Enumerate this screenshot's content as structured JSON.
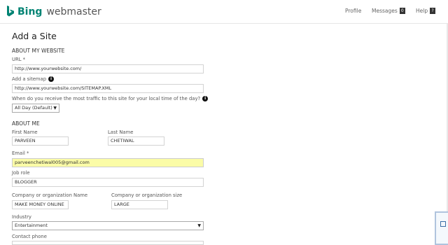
{
  "header": {
    "brand": "Bing",
    "product": "webmaster",
    "nav": {
      "profile": "Profile",
      "messages": "Messages",
      "messages_count": "0",
      "help": "Help",
      "help_badge": "?"
    }
  },
  "page_title": "Add a Site",
  "about_website": {
    "heading": "ABOUT MY WEBSITE",
    "url_label": "URL *",
    "url_value": "http://www.yourwebsite.com/",
    "sitemap_label": "Add a sitemap",
    "sitemap_value": "http://www.yourwebsite.com/SITEMAP.XML",
    "traffic_label": "When do you receive the most traffic to this site for your local time of the day?",
    "traffic_value": "All Day (Default)"
  },
  "about_me": {
    "heading": "ABOUT ME",
    "first_name_label": "First Name",
    "first_name_value": "PARVEEN",
    "last_name_label": "Last Name",
    "last_name_value": "CHETIWAL",
    "email_label": "Email *",
    "email_value": "parveenchetiwal005@gmail.com",
    "job_role_label": "Job role",
    "job_role_value": "BLOGGER",
    "company_label": "Company or organization Name",
    "company_value": "MAKE MONEY ONLINE",
    "company_size_label": "Company or organization size",
    "company_size_value": "LARGE",
    "industry_label": "Industry",
    "industry_value": "Entertainment",
    "phone_label": "Contact phone"
  },
  "colors": {
    "brand": "#008373",
    "email_highlight": "#fbfca7"
  },
  "icons": {
    "info": "info-circle-icon",
    "caret": "caret-down-icon"
  }
}
